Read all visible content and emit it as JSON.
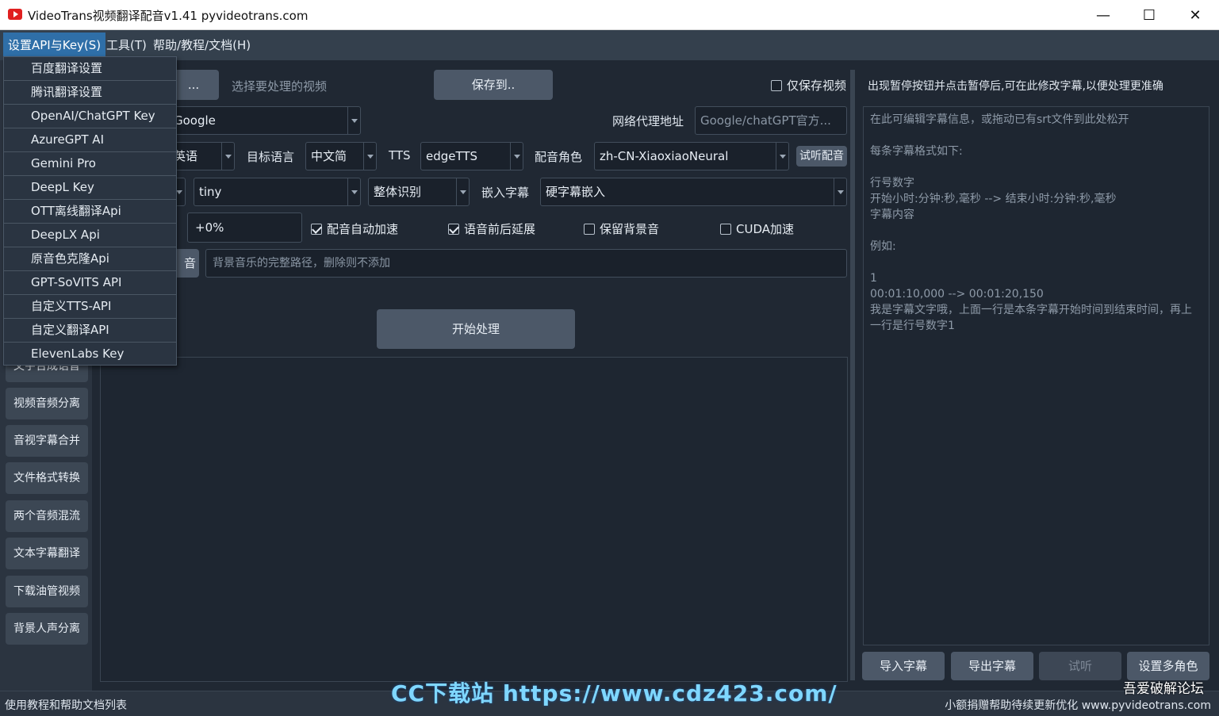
{
  "window": {
    "title": "VideoTrans视频翻译配音v1.41  pyvideotrans.com",
    "minimize": "—",
    "maximize": "☐",
    "close": "✕"
  },
  "menubar": {
    "items": [
      "设置API与Key(S)",
      "工具(T)",
      "帮助/教程/文档(H)"
    ]
  },
  "dropdown": {
    "items": [
      "百度翻译设置",
      "腾讯翻译设置",
      "OpenAI/ChatGPT Key",
      "AzureGPT AI",
      "Gemini Pro",
      "DeepL Key",
      "OTT离线翻译Api",
      "DeepLX Api",
      "原音色克隆Api",
      "GPT-SoVITS API",
      "自定义TTS-API",
      "自定义翻译API",
      "ElevenLabs Key"
    ]
  },
  "sidebar": {
    "items": [
      "文字合成语音",
      "视频音频分离",
      "音视字幕合并",
      "文件格式转换",
      "两个音频混流",
      "文本字幕翻译",
      "下载油管视频",
      "背景人声分离"
    ]
  },
  "main": {
    "select_video_btn": "...",
    "select_video_hint": "选择要处理的视频",
    "save_to_btn": "保存到..",
    "only_save_video": "仅保存视频",
    "translate_engine": "Google",
    "proxy_label": "网络代理地址",
    "proxy_placeholder": "Google/chatGPT官方...",
    "source_lang": "英语",
    "target_lang_label": "目标语言",
    "target_lang": "中文简",
    "tts_label": "TTS",
    "tts_engine": "edgeTTS",
    "voice_role_label": "配音角色",
    "voice_role": "zh-CN-XiaoxiaoNeural",
    "preview_voice_btn": "试听配音",
    "whisper_model": "tiny",
    "recognize_mode": "整体识别",
    "embed_subtitle_label": "嵌入字幕",
    "embed_subtitle": "硬字幕嵌入",
    "voice_rate": "+0%",
    "auto_speed": "配音自动加速",
    "extend_before_after": "语音前后延展",
    "keep_bgm": "保留背景音",
    "cuda": "CUDA加速",
    "bgm_btn": "音",
    "bgm_placeholder": "背景音乐的完整路径，删除则不添加",
    "start_btn": "开始处理"
  },
  "right": {
    "pause_hint": "出现暂停按钮并点击暂停后,可在此修改字幕,以便处理更准确",
    "subtitle_placeholder": "在此可编辑字幕信息，或拖动已有srt文件到此处松开\n\n每条字幕格式如下:\n\n行号数字\n开始小时:分钟:秒,毫秒 --> 结束小时:分钟:秒,毫秒\n字幕内容\n\n例如:\n\n1\n00:01:10,000 --> 00:01:20,150\n我是字幕文字哦，上面一行是本条字幕开始时间到结束时间，再上一行是行号数字1",
    "import_btn": "导入字幕",
    "export_btn": "导出字幕",
    "listen_btn": "试听",
    "multi_role_btn": "设置多角色"
  },
  "status": {
    "left": "使用教程和帮助文档列表",
    "right": "小额捐赠帮助待续更新优化 www.pyvideotrans.com"
  },
  "watermarks": {
    "site": "CC下载站  https://www.cdz423.com/",
    "forum": "吾爱破解论坛"
  }
}
